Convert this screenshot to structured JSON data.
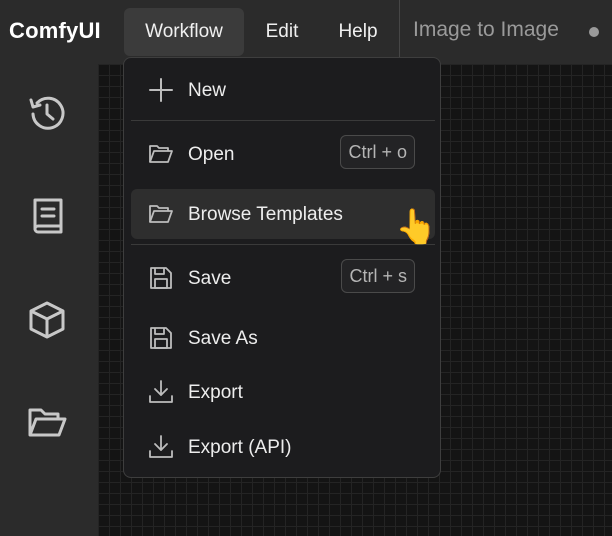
{
  "app": {
    "name": "ComfyUI"
  },
  "menubar": {
    "workflow": "Workflow",
    "edit": "Edit",
    "help": "Help"
  },
  "workflow_tab": {
    "title": "Image to Image",
    "status_icon": "unsaved-dot"
  },
  "sidebar": {
    "icons": [
      "history-icon",
      "book-icon",
      "cube-icon",
      "folder-open-icon"
    ]
  },
  "dropdown": {
    "items": [
      {
        "label": "New",
        "icon": "plus-icon",
        "shortcut": ""
      },
      {
        "label": "Open",
        "icon": "folder-open-icon",
        "shortcut": "Ctrl + o"
      },
      {
        "label": "Browse Templates",
        "icon": "folder-open-icon",
        "shortcut": ""
      },
      {
        "label": "Save",
        "icon": "save-icon",
        "shortcut": "Ctrl + s"
      },
      {
        "label": "Save As",
        "icon": "save-icon",
        "shortcut": ""
      },
      {
        "label": "Export",
        "icon": "download-icon",
        "shortcut": ""
      },
      {
        "label": "Export (API)",
        "icon": "download-icon",
        "shortcut": ""
      }
    ],
    "hovered_item": "Browse Templates"
  },
  "cursor": {
    "icon": "pointing-hand-icon",
    "glyph": "👆"
  },
  "colors": {
    "topbar": "#2b2b2b",
    "menu": "#1c1c1e",
    "hover": "#2e2e2e",
    "canvas": "#141414"
  }
}
